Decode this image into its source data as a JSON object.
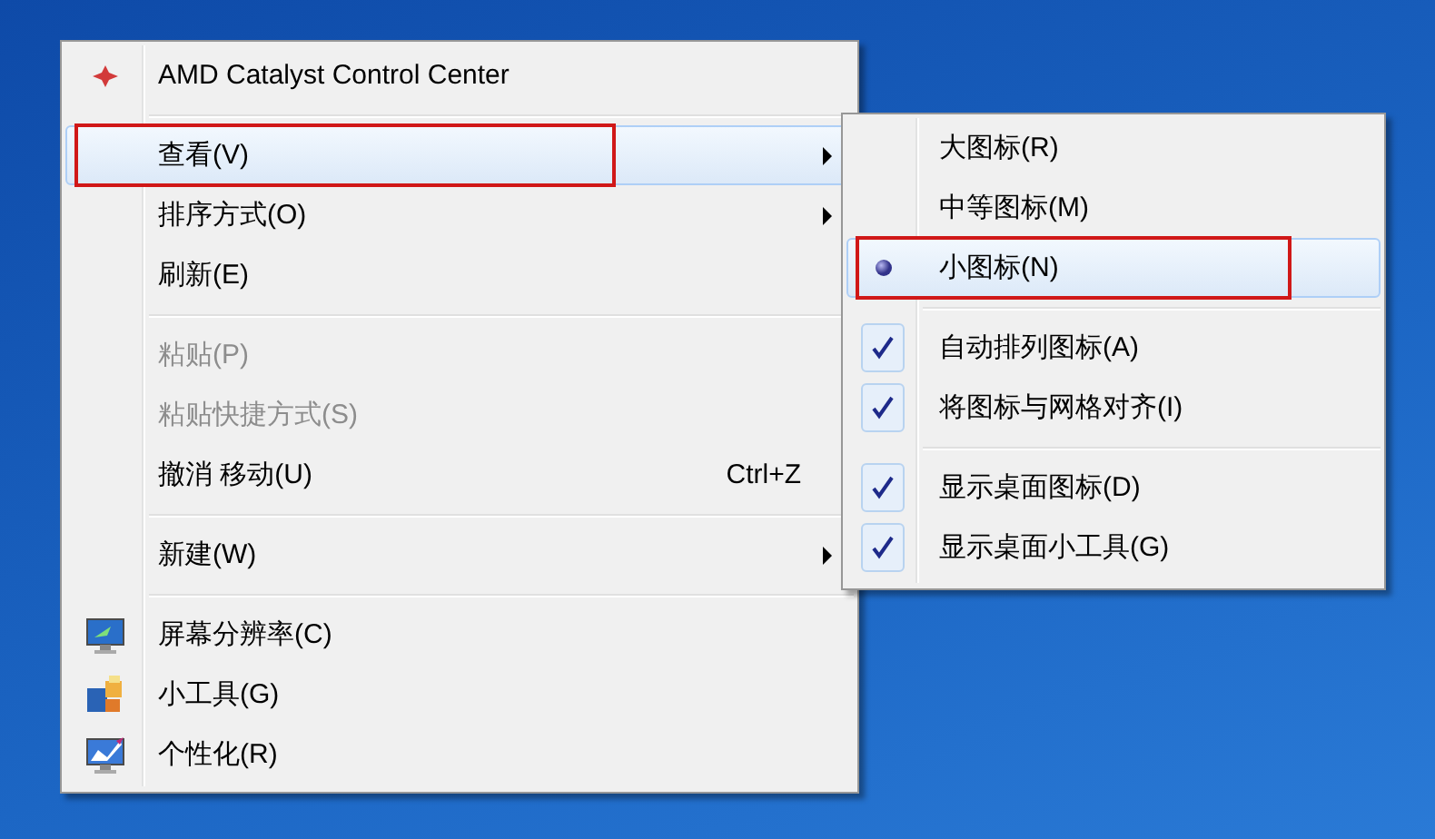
{
  "context_menu": {
    "items": [
      {
        "kind": "item",
        "label": "AMD Catalyst Control Center",
        "disabled": false,
        "hovered": false,
        "submenu": false,
        "annotated": false
      },
      {
        "kind": "separator"
      },
      {
        "kind": "item",
        "label": "查看(V)",
        "disabled": false,
        "hovered": true,
        "submenu": true,
        "annotated": true
      },
      {
        "kind": "item",
        "label": "排序方式(O)",
        "disabled": false,
        "hovered": false,
        "submenu": true,
        "annotated": false
      },
      {
        "kind": "item",
        "label": "刷新(E)",
        "disabled": false,
        "hovered": false,
        "submenu": false,
        "annotated": false
      },
      {
        "kind": "separator"
      },
      {
        "kind": "item",
        "label": "粘贴(P)",
        "disabled": true,
        "hovered": false,
        "submenu": false,
        "annotated": false
      },
      {
        "kind": "item",
        "label": "粘贴快捷方式(S)",
        "disabled": true,
        "hovered": false,
        "submenu": false,
        "annotated": false
      },
      {
        "kind": "item",
        "label": "撤消 移动(U)",
        "shortcut": "Ctrl+Z",
        "disabled": false,
        "hovered": false,
        "submenu": false,
        "annotated": false
      },
      {
        "kind": "separator"
      },
      {
        "kind": "item",
        "label": "新建(W)",
        "disabled": false,
        "hovered": false,
        "submenu": true,
        "annotated": false
      },
      {
        "kind": "separator"
      },
      {
        "kind": "item",
        "label": "屏幕分辨率(C)",
        "disabled": false,
        "hovered": false,
        "submenu": false,
        "annotated": false
      },
      {
        "kind": "item",
        "label": "小工具(G)",
        "disabled": false,
        "hovered": false,
        "submenu": false,
        "annotated": false
      },
      {
        "kind": "item",
        "label": "个性化(R)",
        "disabled": false,
        "hovered": false,
        "submenu": false,
        "annotated": false
      }
    ]
  },
  "view_submenu": {
    "items": [
      {
        "kind": "radio",
        "label": "大图标(R)",
        "selected": false,
        "hovered": false,
        "annotated": false
      },
      {
        "kind": "radio",
        "label": "中等图标(M)",
        "selected": false,
        "hovered": false,
        "annotated": false
      },
      {
        "kind": "radio",
        "label": "小图标(N)",
        "selected": true,
        "hovered": true,
        "annotated": true
      },
      {
        "kind": "separator"
      },
      {
        "kind": "check",
        "label": "自动排列图标(A)",
        "checked": true,
        "hovered": false,
        "annotated": false
      },
      {
        "kind": "check",
        "label": "将图标与网格对齐(I)",
        "checked": true,
        "hovered": false,
        "annotated": false
      },
      {
        "kind": "separator"
      },
      {
        "kind": "check",
        "label": "显示桌面图标(D)",
        "checked": true,
        "hovered": false,
        "annotated": false
      },
      {
        "kind": "check",
        "label": "显示桌面小工具(G)",
        "checked": true,
        "hovered": false,
        "annotated": false
      }
    ]
  }
}
